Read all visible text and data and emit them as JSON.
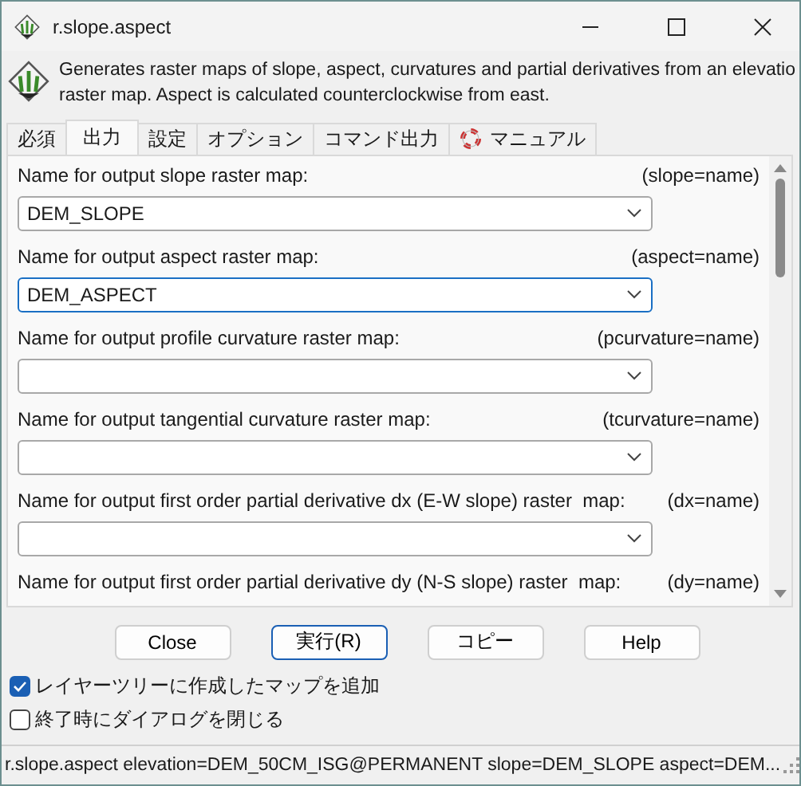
{
  "window": {
    "title": "r.slope.aspect"
  },
  "description": {
    "lines": [
      "Generates raster maps of slope, aspect, curvatures and partial derivatives from an elevatio",
      "raster map. Aspect is calculated counterclockwise from east."
    ]
  },
  "tabs": [
    {
      "label": "必須",
      "selected": false,
      "kind": "text"
    },
    {
      "label": "出力",
      "selected": true,
      "kind": "text"
    },
    {
      "label": "設定",
      "selected": false,
      "kind": "text"
    },
    {
      "label": "オプション",
      "selected": false,
      "kind": "text"
    },
    {
      "label": "コマンド出力",
      "selected": false,
      "kind": "text"
    },
    {
      "label": "マニュアル",
      "selected": false,
      "kind": "help"
    }
  ],
  "fields": [
    {
      "label": "Name for output slope raster map:",
      "param": "(slope=name)",
      "value": "DEM_SLOPE",
      "focused": false
    },
    {
      "label": "Name for output aspect raster map:",
      "param": "(aspect=name)",
      "value": "DEM_ASPECT",
      "focused": true
    },
    {
      "label": "Name for output profile curvature raster map:",
      "param": "(pcurvature=name)",
      "focused": false
    },
    {
      "label": "Name for output tangential curvature raster map:",
      "param": "(tcurvature=name)",
      "focused": false
    },
    {
      "label": "Name for output first order partial derivative dx (E-W slope) raster  map:",
      "param": "(dx=name)",
      "focused": false
    },
    {
      "label": "Name for output first order partial derivative dy (N-S slope) raster  map:",
      "param": "(dy=name)"
    }
  ],
  "buttons": [
    {
      "label": "Close",
      "default": false
    },
    {
      "label": "実行(R)",
      "default": true
    },
    {
      "label": "コピー",
      "default": false
    },
    {
      "label": "Help",
      "default": false
    }
  ],
  "options": [
    {
      "label": "レイヤーツリーに作成したマップを追加",
      "checked": true
    },
    {
      "label": "終了時にダイアログを閉じる",
      "checked": false
    }
  ],
  "status_bar": {
    "text": "r.slope.aspect elevation=DEM_50CM_ISG@PERMANENT slope=DEM_SLOPE aspect=DEM..."
  }
}
